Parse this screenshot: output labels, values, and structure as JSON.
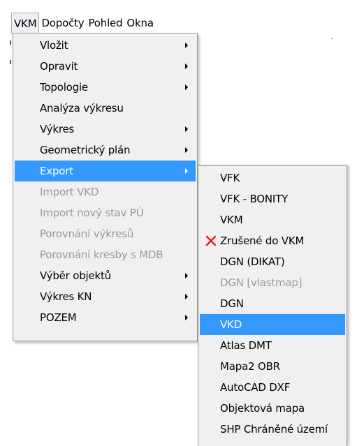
{
  "menubar": {
    "items": [
      "VKM",
      "Dopočty",
      "Pohled",
      "Okna"
    ]
  },
  "main_menu": {
    "items": [
      {
        "label": "Vložit",
        "submenu": true,
        "disabled": false,
        "highlighted": false
      },
      {
        "label": "Opravit",
        "submenu": true,
        "disabled": false,
        "highlighted": false
      },
      {
        "label": "Topologie",
        "submenu": true,
        "disabled": false,
        "highlighted": false
      },
      {
        "label": "Analýza výkresu",
        "submenu": false,
        "disabled": false,
        "highlighted": false
      },
      {
        "label": "Výkres",
        "submenu": true,
        "disabled": false,
        "highlighted": false
      },
      {
        "label": "Geometrický plán",
        "submenu": true,
        "disabled": false,
        "highlighted": false
      },
      {
        "label": "Export",
        "submenu": true,
        "disabled": false,
        "highlighted": true
      },
      {
        "label": "Import VKD",
        "submenu": false,
        "disabled": true,
        "highlighted": false
      },
      {
        "label": "Import nový stav PÚ",
        "submenu": false,
        "disabled": true,
        "highlighted": false
      },
      {
        "label": "Porovnání výkresů",
        "submenu": false,
        "disabled": true,
        "highlighted": false
      },
      {
        "label": "Porovnání  kresby s MDB",
        "submenu": false,
        "disabled": true,
        "highlighted": false
      },
      {
        "label": "Výběr objektů",
        "submenu": true,
        "disabled": false,
        "highlighted": false
      },
      {
        "label": "Výkres KN",
        "submenu": true,
        "disabled": false,
        "highlighted": false
      },
      {
        "label": "POZEM",
        "submenu": true,
        "disabled": false,
        "highlighted": false
      }
    ]
  },
  "export_submenu": {
    "items": [
      {
        "label": "VFK",
        "disabled": false,
        "highlighted": false,
        "icon": null
      },
      {
        "label": "VFK - BONITY",
        "disabled": false,
        "highlighted": false,
        "icon": null
      },
      {
        "label": "VKM",
        "disabled": false,
        "highlighted": false,
        "icon": null
      },
      {
        "label": "Zrušené do VKM",
        "disabled": false,
        "highlighted": false,
        "icon": "red-x-icon"
      },
      {
        "label": "DGN (DIKAT)",
        "disabled": false,
        "highlighted": false,
        "icon": null
      },
      {
        "label": "DGN [vlastmap]",
        "disabled": true,
        "highlighted": false,
        "icon": null
      },
      {
        "label": "DGN",
        "disabled": false,
        "highlighted": false,
        "icon": null
      },
      {
        "label": "VKD",
        "disabled": false,
        "highlighted": true,
        "icon": null
      },
      {
        "label": "Atlas DMT",
        "disabled": false,
        "highlighted": false,
        "icon": null
      },
      {
        "label": "Mapa2 OBR",
        "disabled": false,
        "highlighted": false,
        "icon": null
      },
      {
        "label": "AutoCAD DXF",
        "disabled": false,
        "highlighted": false,
        "icon": null
      },
      {
        "label": "Objektová mapa",
        "disabled": false,
        "highlighted": false,
        "icon": null
      },
      {
        "label": "SHP Chráněné území",
        "disabled": false,
        "highlighted": false,
        "icon": null
      }
    ]
  },
  "colors": {
    "highlight": "#3399ff",
    "disabled_text": "#9a9a9a",
    "menu_background": "#f0f0f0",
    "x_icon": "#e02020"
  }
}
